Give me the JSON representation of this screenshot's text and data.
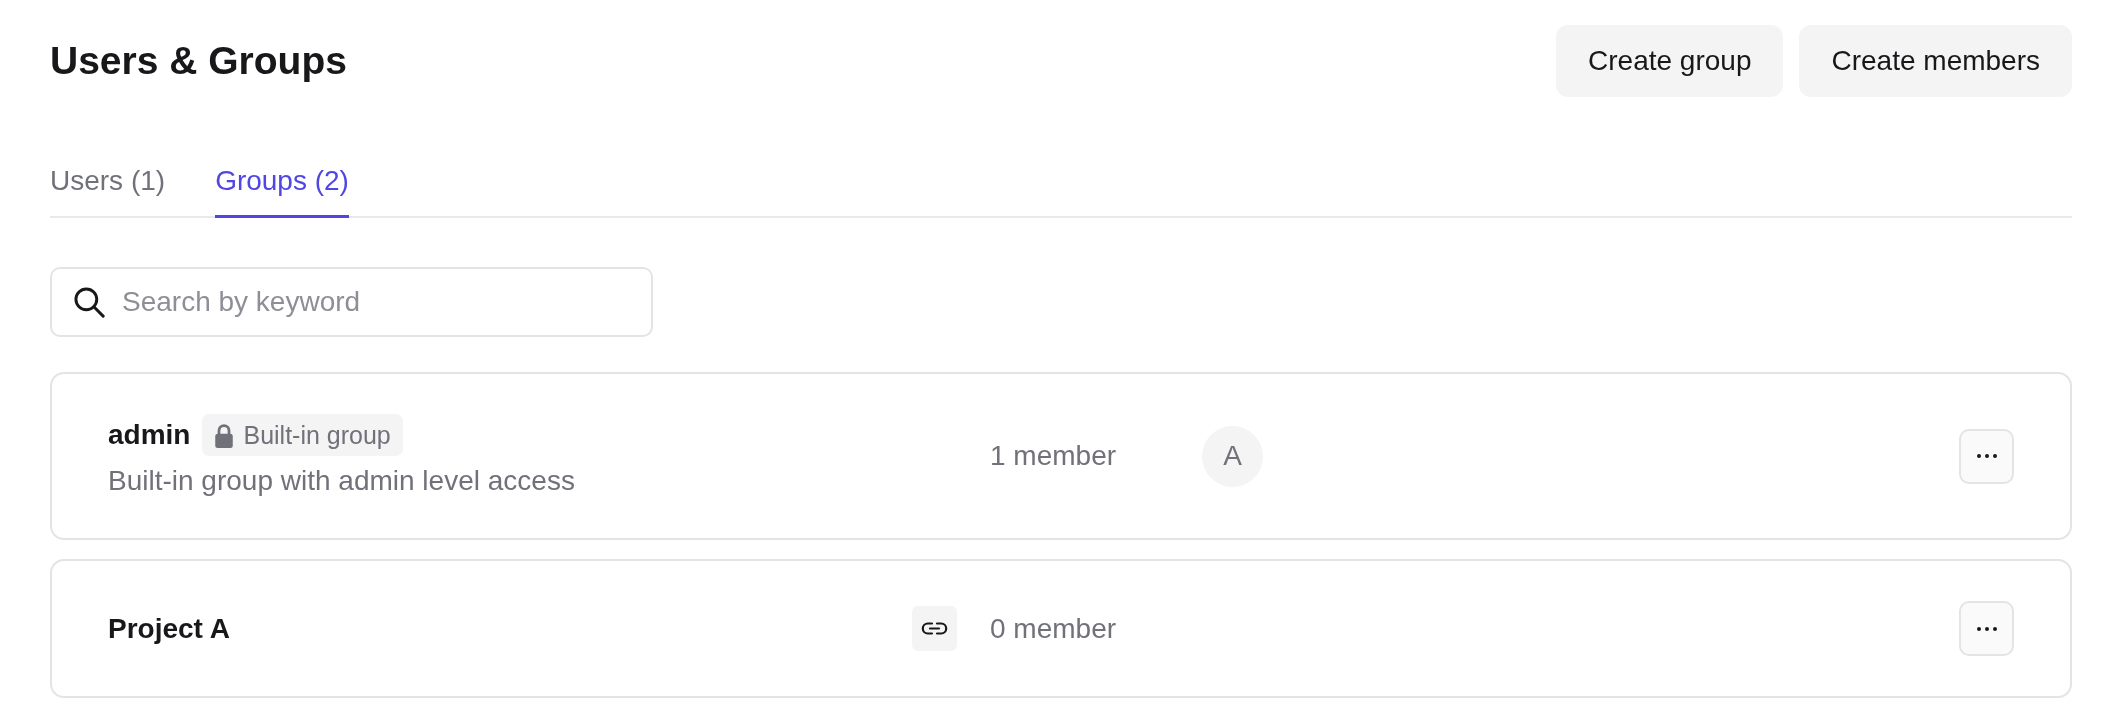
{
  "page": {
    "title": "Users & Groups"
  },
  "header_buttons": [
    "Create group",
    "Create members"
  ],
  "tabs": [
    {
      "label": "Users (1)",
      "selected": false
    },
    {
      "label": "Groups (2)",
      "selected": true
    }
  ],
  "search": {
    "placeholder": "Search by keyword"
  },
  "groups": [
    {
      "name": "admin",
      "badge": "Built-in group",
      "description": "Built-in group with admin level access",
      "linked": false,
      "member_count": "1 member",
      "members": [
        {
          "initial": "A"
        }
      ]
    },
    {
      "name": "Project A",
      "linked": true,
      "member_count": "0 member"
    }
  ]
}
